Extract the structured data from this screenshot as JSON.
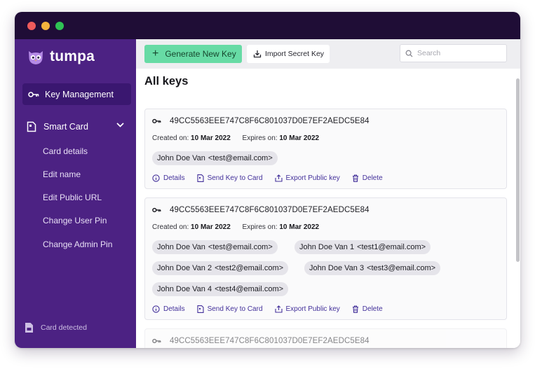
{
  "app": {
    "name": "tumpa"
  },
  "colors": {
    "sidebar": "#4c2283",
    "titlebar": "#1f0d36",
    "accent_green": "#67dba5",
    "action_link": "#43309a"
  },
  "sidebar": {
    "key_management": "Key Management",
    "smart_card": "Smart Card",
    "smart_card_items": [
      "Card details",
      "Edit name",
      "Edit Public URL",
      "Change User Pin",
      "Change Admin Pin"
    ],
    "card_status": "Card detected"
  },
  "toolbar": {
    "generate_label": "Generate New Key",
    "import_label": "Import Secret Key",
    "search_placeholder": "Search",
    "search_value": ""
  },
  "main": {
    "title": "All keys",
    "keys": [
      {
        "fingerprint": "49CC5563EEE747C8F6C801037D0E7EF2AEDC5E84",
        "created_label": "Created on:",
        "created": "10 Mar 2022",
        "expires_label": "Expires on:",
        "expires": "10 Mar 2022",
        "uids": [
          {
            "name": "John Doe Van",
            "email": "<test@email.com>"
          }
        ]
      },
      {
        "fingerprint": "49CC5563EEE747C8F6C801037D0E7EF2AEDC5E84",
        "created_label": "Created on:",
        "created": "10 Mar 2022",
        "expires_label": "Expires on:",
        "expires": "10 Mar 2022",
        "uids": [
          {
            "name": "John Doe Van",
            "email": "<test@email.com>"
          },
          {
            "name": "John Doe Van 1",
            "email": "<test1@email.com>"
          },
          {
            "name": "John Doe Van 2",
            "email": "<test2@email.com>"
          },
          {
            "name": "John Doe Van 3",
            "email": "<test3@email.com>"
          },
          {
            "name": "John Doe Van 4",
            "email": "<test4@email.com>"
          }
        ]
      },
      {
        "fingerprint": "49CC5563EEE747C8F6C801037D0E7EF2AEDC5E84"
      }
    ],
    "actions": {
      "details": "Details",
      "send": "Send Key to Card",
      "export": "Export Public key",
      "delete": "Delete"
    }
  }
}
